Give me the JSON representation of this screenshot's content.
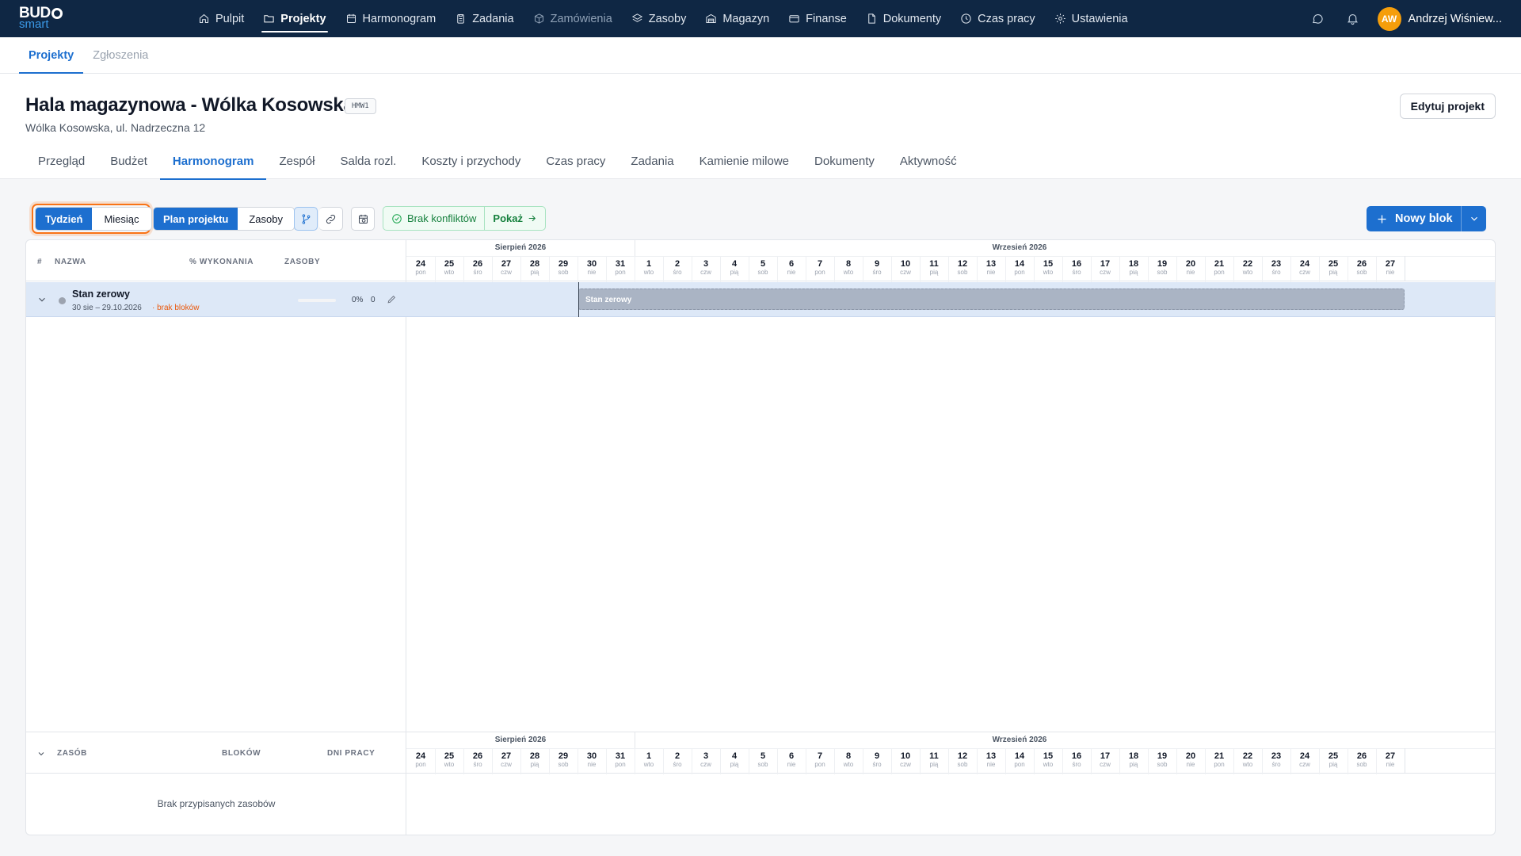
{
  "brand": {
    "line1": "BUD",
    "line2": "smart"
  },
  "nav": [
    {
      "label": "Pulpit",
      "icon": "home-icon",
      "state": "normal"
    },
    {
      "label": "Projekty",
      "icon": "folder-icon",
      "state": "active"
    },
    {
      "label": "Harmonogram",
      "icon": "calendar-icon",
      "state": "normal"
    },
    {
      "label": "Zadania",
      "icon": "clipboard-icon",
      "state": "normal"
    },
    {
      "label": "Zamówienia",
      "icon": "box-icon",
      "state": "disabled"
    },
    {
      "label": "Zasoby",
      "icon": "layers-icon",
      "state": "normal"
    },
    {
      "label": "Magazyn",
      "icon": "warehouse-icon",
      "state": "normal"
    },
    {
      "label": "Finanse",
      "icon": "card-icon",
      "state": "normal"
    },
    {
      "label": "Dokumenty",
      "icon": "document-icon",
      "state": "normal"
    },
    {
      "label": "Czas pracy",
      "icon": "clock-icon",
      "state": "normal"
    },
    {
      "label": "Ustawienia",
      "icon": "gear-icon",
      "state": "normal"
    }
  ],
  "user": {
    "initials": "AW",
    "name": "Andrzej Wiśniew..."
  },
  "subtabs": [
    {
      "label": "Projekty",
      "active": true
    },
    {
      "label": "Zgłoszenia",
      "active": false
    }
  ],
  "project": {
    "title": "Hala magazynowa - Wólka Kosowska",
    "code": "HMW1",
    "address": "Wólka Kosowska, ul. Nadrzeczna 12",
    "edit_label": "Edytuj projekt"
  },
  "project_tabs": [
    {
      "label": "Przegląd",
      "active": false
    },
    {
      "label": "Budżet",
      "active": false
    },
    {
      "label": "Harmonogram",
      "active": true
    },
    {
      "label": "Zespół",
      "active": false
    },
    {
      "label": "Salda rozl.",
      "active": false
    },
    {
      "label": "Koszty i przychody",
      "active": false
    },
    {
      "label": "Czas pracy",
      "active": false
    },
    {
      "label": "Zadania",
      "active": false
    },
    {
      "label": "Kamienie milowe",
      "active": false
    },
    {
      "label": "Dokumenty",
      "active": false
    },
    {
      "label": "Aktywność",
      "active": false
    }
  ],
  "toolbar": {
    "view_week": "Tydzień",
    "view_month": "Miesiąc",
    "mode_plan": "Plan projektu",
    "mode_resources": "Zasoby",
    "conflicts": "Brak konfliktów",
    "show": "Pokaż",
    "new_block": "Nowy blok"
  },
  "grid": {
    "headers": {
      "num": "#",
      "name": "NAZWA",
      "progress": "% WYKONANIA",
      "resources": "ZASOBY"
    },
    "months": [
      {
        "label": "Sierpień 2026",
        "start_index": 0,
        "span": 8
      },
      {
        "label": "Wrzesień 2026",
        "start_index": 8,
        "span": 27
      }
    ],
    "days": [
      {
        "n": "24",
        "w": "pon"
      },
      {
        "n": "25",
        "w": "wto"
      },
      {
        "n": "26",
        "w": "śro"
      },
      {
        "n": "27",
        "w": "czw"
      },
      {
        "n": "28",
        "w": "pią"
      },
      {
        "n": "29",
        "w": "sob"
      },
      {
        "n": "30",
        "w": "nie"
      },
      {
        "n": "31",
        "w": "pon"
      },
      {
        "n": "1",
        "w": "wto"
      },
      {
        "n": "2",
        "w": "śro"
      },
      {
        "n": "3",
        "w": "czw"
      },
      {
        "n": "4",
        "w": "pią"
      },
      {
        "n": "5",
        "w": "sob"
      },
      {
        "n": "6",
        "w": "nie"
      },
      {
        "n": "7",
        "w": "pon"
      },
      {
        "n": "8",
        "w": "wto"
      },
      {
        "n": "9",
        "w": "śro"
      },
      {
        "n": "10",
        "w": "czw"
      },
      {
        "n": "11",
        "w": "pią"
      },
      {
        "n": "12",
        "w": "sob"
      },
      {
        "n": "13",
        "w": "nie"
      },
      {
        "n": "14",
        "w": "pon"
      },
      {
        "n": "15",
        "w": "wto"
      },
      {
        "n": "16",
        "w": "śro"
      },
      {
        "n": "17",
        "w": "czw"
      },
      {
        "n": "18",
        "w": "pią"
      },
      {
        "n": "19",
        "w": "sob"
      },
      {
        "n": "20",
        "w": "nie"
      },
      {
        "n": "21",
        "w": "pon"
      },
      {
        "n": "22",
        "w": "wto"
      },
      {
        "n": "23",
        "w": "śro"
      },
      {
        "n": "24",
        "w": "czw"
      },
      {
        "n": "25",
        "w": "pią"
      },
      {
        "n": "26",
        "w": "sob"
      },
      {
        "n": "27",
        "w": "nie"
      }
    ],
    "rows": [
      {
        "name": "Stan zerowy",
        "dates": "30 sie – 29.10.2026",
        "warning": "· brak bloków",
        "progress_pct": "0%",
        "progress_value": 0,
        "resources": "0",
        "bar_label": "Stan zerowy",
        "bar_start_index": 6
      }
    ]
  },
  "resources_panel": {
    "headers": {
      "resource": "ZASÓB",
      "blocks": "BLOKÓW",
      "workdays": "DNI PRACY"
    },
    "empty": "Brak przypisanych zasobów"
  }
}
